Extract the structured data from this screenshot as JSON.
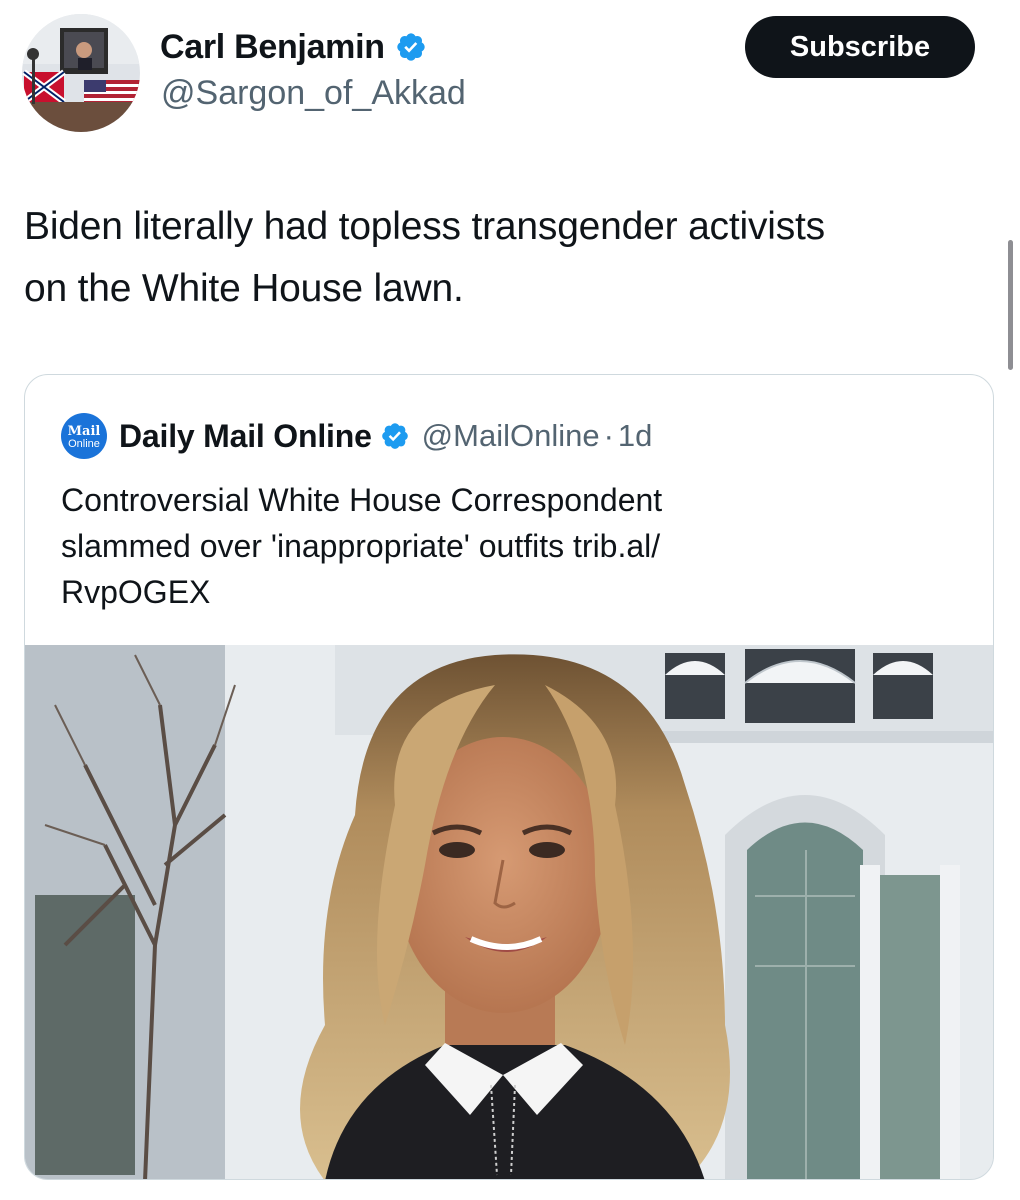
{
  "author": {
    "name": "Carl Benjamin",
    "handle": "@Sargon_of_Akkad",
    "verified": true,
    "avatar_icon": "profile-photo-flags"
  },
  "actions": {
    "subscribe_label": "Subscribe"
  },
  "tweet": {
    "text_line1": "Biden literally had topless transgender activists",
    "text_line2": "on the White House lawn."
  },
  "quoted": {
    "logo_line1": "Mail",
    "logo_line2": "Online",
    "name": "Daily Mail Online",
    "verified": true,
    "handle": "@MailOnline",
    "separator": "·",
    "time": "1d",
    "text_line1": "Controversial White House Correspondent",
    "text_line2": "slammed over 'inappropriate' outfits trib.al/",
    "text_line3": "RvpOGEX",
    "image_icon": "photo-woman-white-house"
  },
  "colors": {
    "text_primary": "#0f1419",
    "text_secondary": "#536471",
    "verified_blue": "#1d9bf0",
    "button_bg": "#0f1419",
    "card_border": "#cfd9de",
    "mail_logo_blue": "#1a73d9"
  }
}
